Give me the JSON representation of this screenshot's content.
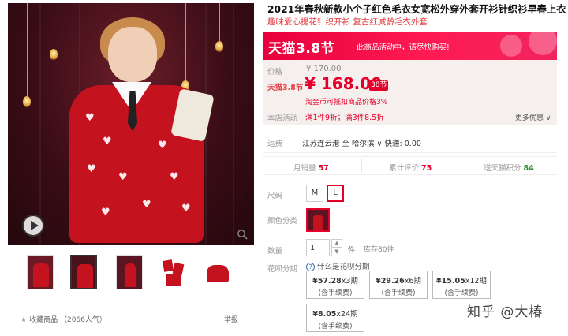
{
  "product": {
    "title": "2021年春秋新款小个子红色毛衣女宽松外穿外套开衫针织衫早春上衣",
    "subtitle": "趣味爱心提花针织开衫 复古红减龄毛衣外套"
  },
  "gallery": {
    "play_icon": "play-icon",
    "zoom_icon": "magnifier-icon",
    "thumbnails": [
      "thumb-1",
      "thumb-2",
      "thumb-3",
      "thumb-4",
      "thumb-5"
    ],
    "active_thumbnail": 2
  },
  "favorite": {
    "icon": "star-icon",
    "label": "收藏商品",
    "popularity": "（2066人气）"
  },
  "report_label": "举报",
  "banner": {
    "brand": "天猫3.8节",
    "promo_text": "此商品活动中，请尽快购买!",
    "color": "#ff1a52"
  },
  "pricing": {
    "original_label": "价格",
    "original_price": "¥ 170.00",
    "tmall_label": "天猫3.8节",
    "current_price": "¥ 168.00",
    "badge": "38节",
    "coin_note": "淘金币可抵扣商品价格3%",
    "event_label": "本店活动",
    "event_text": "满1件9折；满3件8.5折",
    "more_offers": "更多优惠",
    "price_color": "#e4002b"
  },
  "shipping": {
    "label": "运费",
    "text": "江苏连云港 至 哈尔滨 ∨ 快递: 0.00"
  },
  "stats": {
    "monthly_sales_label": "月销量",
    "monthly_sales": "57",
    "reviews_label": "累计评价",
    "reviews": "75",
    "points_label": "送天猫积分",
    "points": "84"
  },
  "options": {
    "size_label": "尺码",
    "sizes": [
      "M",
      "L"
    ],
    "selected_size": "L",
    "color_label": "颜色分类",
    "quantity_label": "数量",
    "quantity": "1",
    "quantity_unit": "件",
    "stock": "库存80件"
  },
  "huabei": {
    "label": "花呗分期",
    "info": "什么是花呗分期",
    "plans": [
      {
        "amount": "¥57.28",
        "periods": "x3期",
        "fee": "(含手续费)"
      },
      {
        "amount": "¥29.26",
        "periods": "x6期",
        "fee": "(含手续费)"
      },
      {
        "amount": "¥15.05",
        "periods": "x12期",
        "fee": "(含手续费)"
      },
      {
        "amount": "¥8.05",
        "periods": "x24期",
        "fee": "(含手续费)"
      }
    ]
  },
  "watermark": "知乎 @大椿"
}
